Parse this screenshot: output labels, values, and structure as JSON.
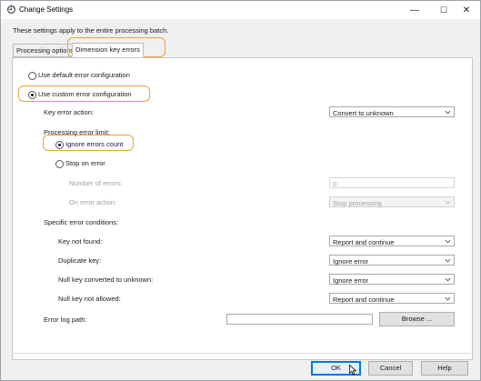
{
  "window": {
    "title": "Change Settings",
    "minimize_glyph": "—",
    "maximize_glyph": "☐",
    "close_glyph": "✕",
    "app_icon": "settings-dialog-icon"
  },
  "note": "These settings apply to the entire processing batch.",
  "tabs": [
    {
      "label": "Processing options",
      "active": false
    },
    {
      "label": "Dimension key errors",
      "active": true
    }
  ],
  "config": {
    "default_label": "Use default error configuration",
    "custom_label": "Use custom error configuration",
    "selected": "custom"
  },
  "key_error_action": {
    "label": "Key error action:",
    "value": "Convert to unknown"
  },
  "processing_limit": {
    "label": "Processing error limit:",
    "ignore_label": "Ignore errors count",
    "stop_label": "Stop on error",
    "selected": "ignore",
    "number_label": "Number of errors:",
    "number_value": "0",
    "on_error_label": "On error action:",
    "on_error_value": "Stop processing"
  },
  "conditions": {
    "label": "Specific error conditions:",
    "rows": [
      {
        "label": "Key not found:",
        "value": "Report and continue"
      },
      {
        "label": "Duplicate key:",
        "value": "Ignore error"
      },
      {
        "label": "Null key converted to unknown:",
        "value": "Ignore error"
      },
      {
        "label": "Null key not allowed:",
        "value": "Report and continue"
      }
    ]
  },
  "error_log": {
    "label": "Error log path:",
    "value": "",
    "browse_label": "Browse ..."
  },
  "footer": {
    "ok_label": "OK",
    "cancel_label": "Cancel",
    "help_label": "Help"
  },
  "colors": {
    "highlight": "#e8a33b",
    "accent": "#0078d7"
  }
}
